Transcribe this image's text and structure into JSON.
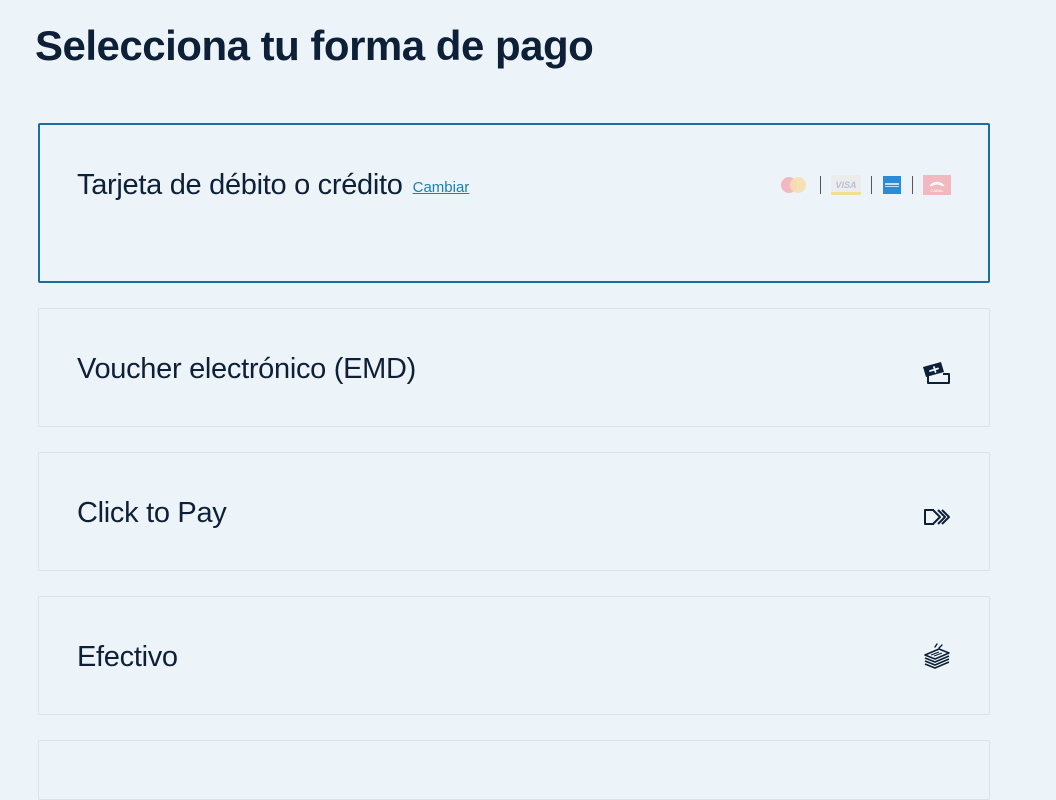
{
  "page": {
    "title": "Selecciona tu forma de pago"
  },
  "payment_options": [
    {
      "label": "Tarjeta de débito o crédito",
      "change_link": "Cambiar",
      "selected": true,
      "brands": [
        "mastercard-icon",
        "visa-icon",
        "amex-icon",
        "cabal-icon"
      ],
      "brand_text": {
        "visa": "VISA",
        "cabal": "CABAL"
      }
    },
    {
      "label": "Voucher electrónico (EMD)",
      "icon": "voucher-ticket-icon",
      "selected": false
    },
    {
      "label": "Click to Pay",
      "icon": "click-to-pay-icon",
      "selected": false
    },
    {
      "label": "Efectivo",
      "icon": "cash-stack-icon",
      "selected": false
    }
  ],
  "colors": {
    "background": "#ecf4f9",
    "text": "#0e2038",
    "selected_border": "#1a6d9e",
    "link": "#1a7fb5"
  }
}
